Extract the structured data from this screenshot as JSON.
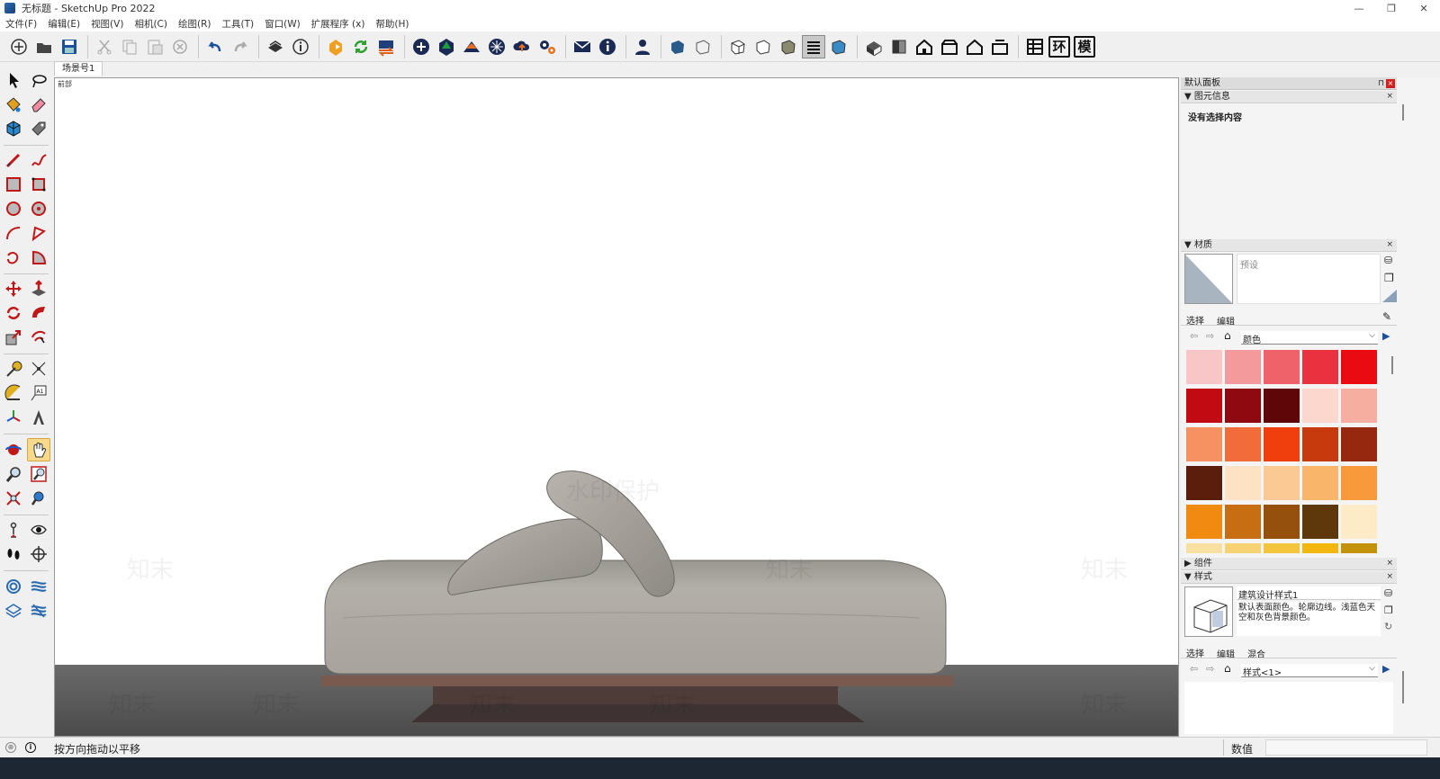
{
  "window": {
    "title": "无标题 - SketchUp Pro 2022",
    "minimize": "—",
    "maximize": "❐",
    "close": "✕"
  },
  "menu": [
    "文件(F)",
    "编辑(E)",
    "视图(V)",
    "相机(C)",
    "绘图(R)",
    "工具(T)",
    "窗口(W)",
    "扩展程序 (x)",
    "帮助(H)"
  ],
  "toolbar": {
    "text_buttons": [
      "环",
      "模"
    ]
  },
  "scene_tab": "场景号1",
  "viewport": {
    "view_label": "前部"
  },
  "panel": {
    "title": "默认面板",
    "entity_info": {
      "title": "图元信息",
      "status": "没有选择内容"
    },
    "materials": {
      "title": "材质",
      "preset": "预设",
      "tab_select": "选择",
      "tab_edit": "编辑",
      "collection": "颜色",
      "swatches": [
        "#f8c6c6",
        "#f59a9c",
        "#f0626a",
        "#ea3140",
        "#ea0a12",
        "#c20a12",
        "#8e0a10",
        "#5e0608",
        "#fcd7cd",
        "#f6aea0",
        "#f69262",
        "#f26b3a",
        "#f03e0c",
        "#c63a0e",
        "#962810",
        "#5c1e0c",
        "#fde2c4",
        "#fbc994",
        "#f9b56a",
        "#f89a3c",
        "#f08a10",
        "#c86e12",
        "#96500e",
        "#5e380a",
        "#fdebc8",
        "#f8e0a0",
        "#f6d272",
        "#f4c43c",
        "#f2b60c",
        "#c4920a"
      ]
    },
    "components": {
      "title": "组件"
    },
    "styles": {
      "title": "样式",
      "style_name": "建筑设计样式1",
      "style_desc": "默认表面颜色。轮廓边线。浅蓝色天空和灰色背景颜色。",
      "tab_select": "选择",
      "tab_edit": "编辑",
      "tab_mix": "混合",
      "collection": "样式<1>"
    }
  },
  "status": {
    "hint": "按方向拖动以平移",
    "measurements_label": "数值"
  },
  "watermark": {
    "brand": "知末",
    "text": "水印保护"
  }
}
